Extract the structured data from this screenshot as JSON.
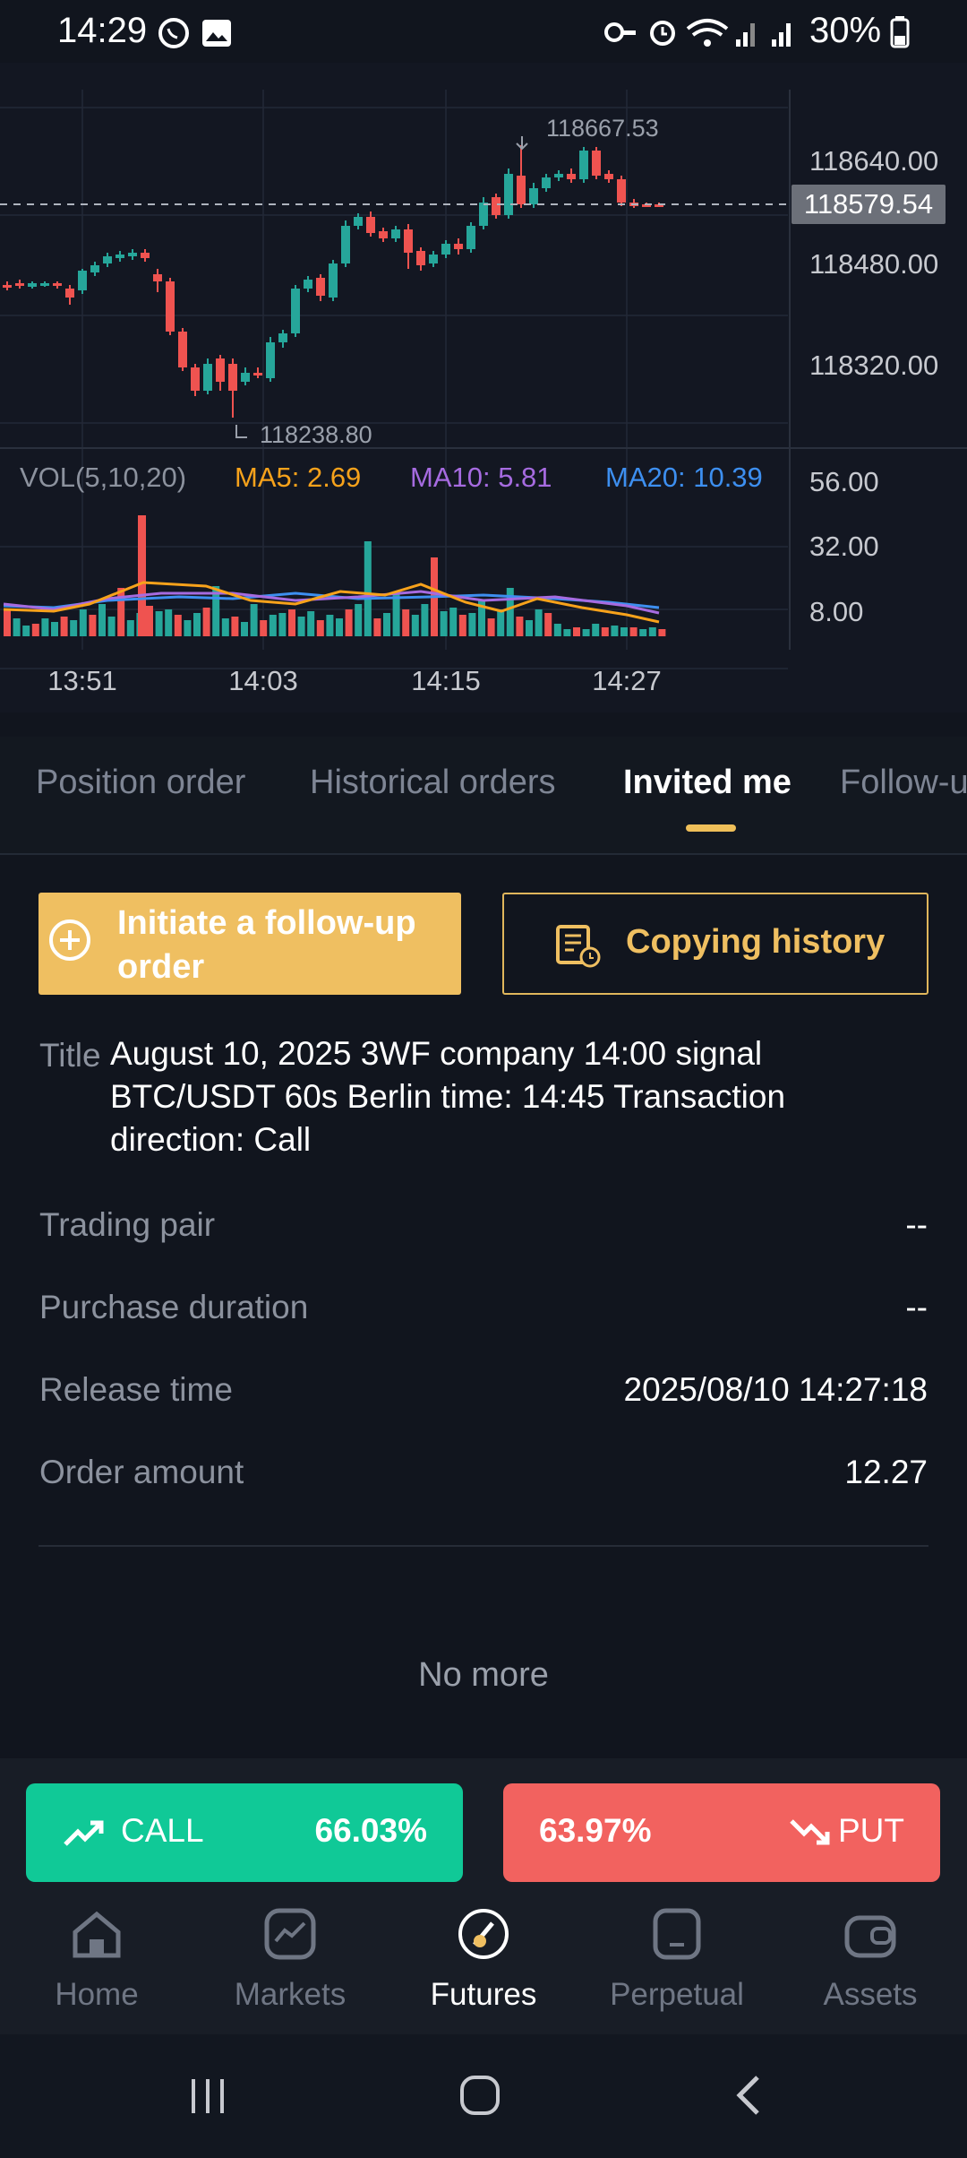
{
  "status_bar": {
    "time": "14:29",
    "battery": "30%",
    "icons": [
      "whatsapp-icon",
      "gallery-icon",
      "key-icon",
      "alarm-icon",
      "wifi-icon",
      "signal-icon",
      "signal-icon",
      "battery-icon"
    ]
  },
  "chart": {
    "price_high_label": "118667.53",
    "price_low_label": "118238.80",
    "current_price": "118579.54",
    "price_ticks": [
      "118640.00",
      "118480.00",
      "118320.00"
    ],
    "volume_header": {
      "vol": "VOL(5,10,20)",
      "ma5": "MA5: 2.69",
      "ma10": "MA10: 5.81",
      "ma20": "MA20: 10.39"
    },
    "volume_ticks": [
      "56.00",
      "32.00",
      "8.00"
    ],
    "time_ticks": [
      "13:51",
      "14:03",
      "14:15",
      "14:27"
    ],
    "colors": {
      "up": "#26a69a",
      "down": "#ef5350",
      "ma5": "#f7a21b",
      "ma10": "#a66be0",
      "ma20": "#3d8ff0"
    }
  },
  "tabs": {
    "items": [
      "Position order",
      "Historical orders",
      "Invited me",
      "Follow-u"
    ],
    "active_index": 2
  },
  "actions": {
    "follow_up": "Initiate a follow-up order",
    "copy_history": "Copying history"
  },
  "details": {
    "title_label": "Title",
    "title_value": "August 10, 2025 3WF company 14:00 signal BTC/USDT 60s Berlin time: 14:45 Transaction direction: Call",
    "rows": [
      {
        "label": "Trading pair",
        "value": "--"
      },
      {
        "label": "Purchase duration",
        "value": "--"
      },
      {
        "label": "Release time",
        "value": "2025/08/10 14:27:18"
      },
      {
        "label": "Order amount",
        "value": "12.27"
      }
    ],
    "no_more": "No more"
  },
  "trade": {
    "call_label": "CALL",
    "call_pct": "66.03%",
    "put_label": "PUT",
    "put_pct": "63.97%"
  },
  "nav": {
    "items": [
      "Home",
      "Markets",
      "Futures",
      "Perpetual",
      "Assets"
    ],
    "active_index": 2
  }
}
